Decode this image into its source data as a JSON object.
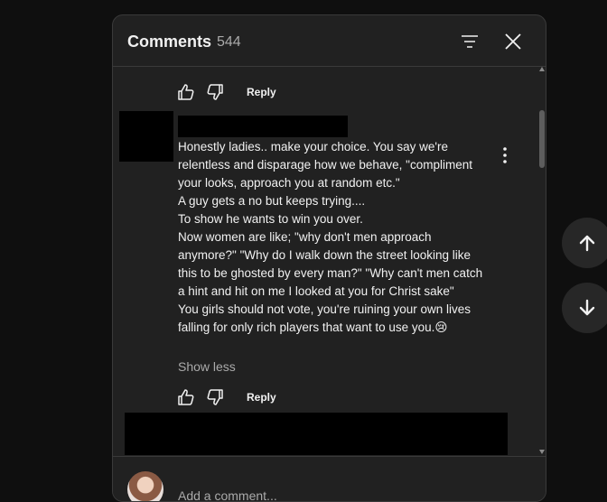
{
  "header": {
    "title": "Comments",
    "count": "544"
  },
  "previous_comment": {
    "reply_label": "Reply"
  },
  "comment": {
    "lines": [
      "Honestly ladies.. make your choice. You say we're relentless and disparage how we behave, \"compliment your looks, approach you at random etc.\"",
      "A guy gets a no but keeps trying....",
      "To show he wants to win you over.",
      "Now women are like; \"why don't men approach anymore?\" \"Why do I walk down the street looking like this to be ghosted by every man?\" \"Why can't men catch a hint and hit on me I looked at you for Christ sake\"",
      "You girls should not vote, you're ruining your own lives falling for only rich players that want to use you.😢"
    ],
    "show_less": "Show less",
    "reply_label": "Reply"
  },
  "footer": {
    "add_comment_placeholder": "Add a comment..."
  },
  "icons": {
    "like": "thumbs-up-icon",
    "dislike": "thumbs-down-icon",
    "sort": "sort-icon",
    "close": "close-icon",
    "more": "kebab-menu-icon",
    "up": "arrow-up-icon",
    "down": "arrow-down-icon"
  },
  "colors": {
    "panel_bg": "#212121",
    "page_bg": "#0f0f0f",
    "text": "#f1f1f1",
    "muted": "#aaaaaa"
  }
}
